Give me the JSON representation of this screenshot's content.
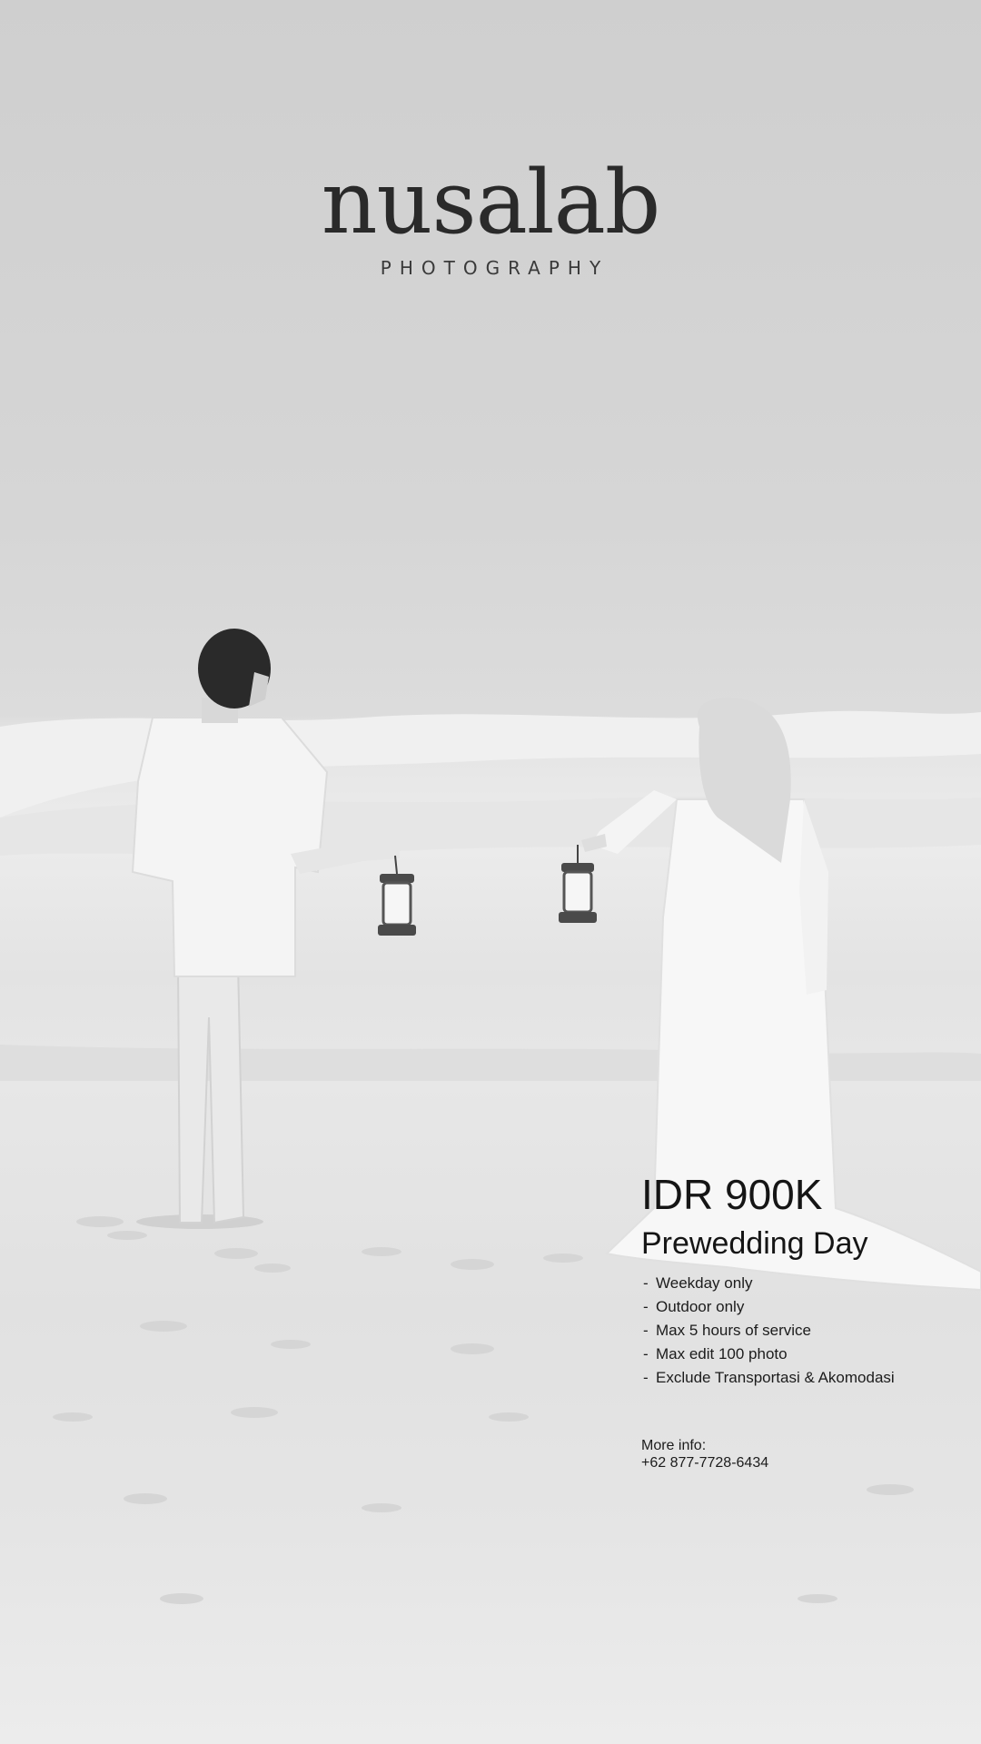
{
  "brand": {
    "name": "nusalab",
    "tagline": "PHOTOGRAPHY"
  },
  "offer": {
    "price": "IDR 900K",
    "package": "Prewedding Day",
    "features": [
      "Weekday only",
      "Outdoor only",
      "Max 5 hours of service",
      "Max edit 100 photo",
      "Exclude Transportasi & Akomodasi"
    ]
  },
  "contact": {
    "label": "More info:",
    "phone": "+62 877-7728-6434"
  },
  "colors": {
    "text": "#1a1a1a",
    "sky": "#d4d4d4",
    "sand": "#e6e6e6"
  }
}
